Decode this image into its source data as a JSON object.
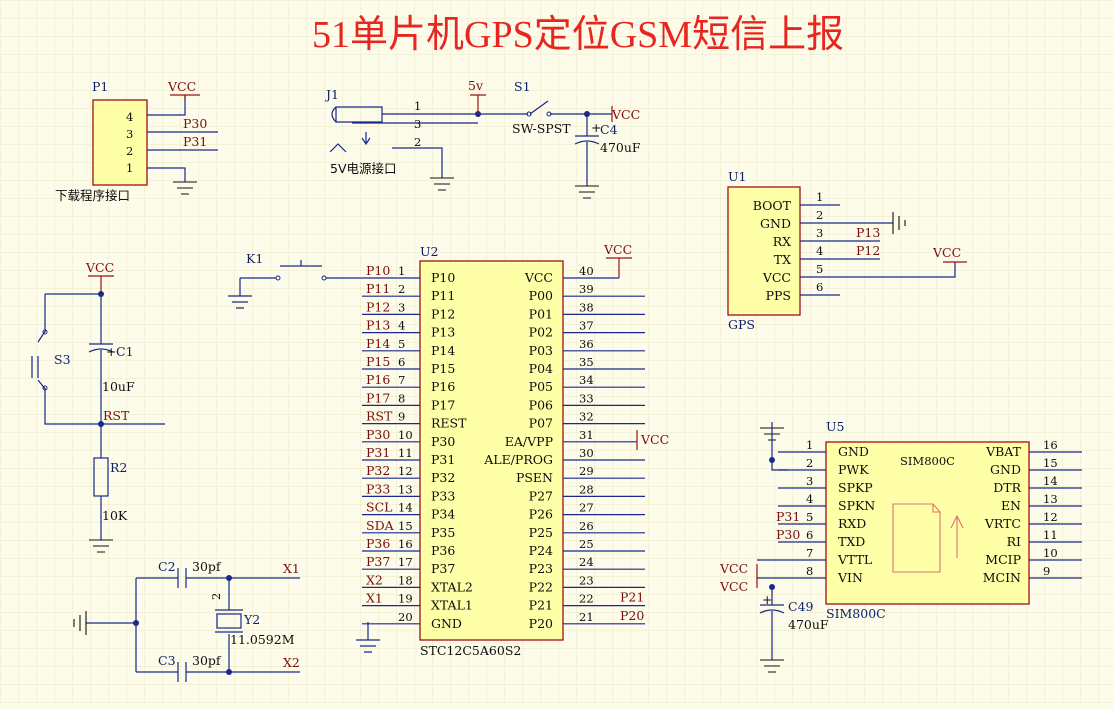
{
  "title": "51单片机GPS定位GSM短信上报",
  "p1": {
    "ref": "P1",
    "vcc": "VCC",
    "pins": [
      "4",
      "3",
      "2",
      "1"
    ],
    "nets": [
      "P30",
      "P31"
    ],
    "caption": "下载程序接口"
  },
  "power": {
    "j1": "J1",
    "j1_pins": [
      "1",
      "3",
      "2"
    ],
    "j1_caption": "5V电源接口",
    "v5": "5v",
    "s1": "S1",
    "s1_type": "SW-SPST",
    "vcc": "VCC",
    "c4": "C4",
    "c4_val": "470uF",
    "plus": "+"
  },
  "gps": {
    "ref": "U1",
    "name": "GPS",
    "pins": [
      "BOOT",
      "GND",
      "RX",
      "TX",
      "VCC",
      "PPS"
    ],
    "nums": [
      "1",
      "2",
      "3",
      "4",
      "5",
      "6"
    ],
    "nets": [
      "P13",
      "P12"
    ],
    "vcc": "VCC"
  },
  "reset": {
    "vcc": "VCC",
    "s3": "S3",
    "c1": "C1",
    "c1_val": "10uF",
    "rst": "RST",
    "r2": "R2",
    "r2_val": "10K",
    "plus": "+"
  },
  "k1": {
    "ref": "K1"
  },
  "mcu": {
    "ref": "U2",
    "part": "STC12C5A60S2",
    "vcc": "VCC",
    "vcc31": "VCC",
    "left_nets": [
      "P10",
      "P11",
      "P12",
      "P13",
      "P14",
      "P15",
      "P16",
      "P17",
      "RST",
      "P30",
      "P31",
      "P32",
      "P33",
      "SCL",
      "SDA",
      "P36",
      "P37",
      "X2",
      "X1",
      ""
    ],
    "left_nums": [
      "1",
      "2",
      "3",
      "4",
      "5",
      "6",
      "7",
      "8",
      "9",
      "10",
      "11",
      "12",
      "13",
      "14",
      "15",
      "16",
      "17",
      "18",
      "19",
      "20"
    ],
    "left_names": [
      "P10",
      "P11",
      "P12",
      "P13",
      "P14",
      "P15",
      "P16",
      "P17",
      "REST",
      "P30",
      "P31",
      "P32",
      "P33",
      "P34",
      "P35",
      "P36",
      "P37",
      "XTAL2",
      "XTAL1",
      "GND"
    ],
    "right_names": [
      "VCC",
      "P00",
      "P01",
      "P02",
      "P03",
      "P04",
      "P05",
      "P06",
      "P07",
      "EA/VPP",
      "ALE/PROG",
      "PSEN",
      "P27",
      "P26",
      "P25",
      "P24",
      "P23",
      "P22",
      "P21",
      "P20"
    ],
    "right_nums": [
      "40",
      "39",
      "38",
      "37",
      "36",
      "35",
      "34",
      "33",
      "32",
      "31",
      "30",
      "29",
      "28",
      "27",
      "26",
      "25",
      "24",
      "23",
      "22",
      "21"
    ],
    "right_nets": [
      "P21",
      "P20"
    ]
  },
  "crystal": {
    "c2": "C2",
    "c2_val": "30pf",
    "c3": "C3",
    "c3_val": "30pf",
    "x1": "X1",
    "x2": "X2",
    "y2": "Y2",
    "y2_val": "11.0592M",
    "pin2": "2"
  },
  "gsm": {
    "ref": "U5",
    "chip": "SIM800C",
    "name": "SIM800C",
    "left_nums": [
      "1",
      "2",
      "3",
      "4",
      "5",
      "6",
      "7",
      "8"
    ],
    "left_names": [
      "GND",
      "PWK",
      "SPKP",
      "SPKN",
      "RXD",
      "TXD",
      "VTTL",
      "VIN"
    ],
    "right_names": [
      "VBAT",
      "GND",
      "DTR",
      "EN",
      "VRTC",
      "RI",
      "MCIP",
      "MCIN"
    ],
    "right_nums": [
      "16",
      "15",
      "14",
      "13",
      "12",
      "11",
      "10",
      "9"
    ],
    "nets": [
      "P31",
      "P30"
    ],
    "vcc1": "VCC",
    "vcc2": "VCC",
    "c49": "C49",
    "c49_val": "470uF",
    "plus": "+"
  }
}
